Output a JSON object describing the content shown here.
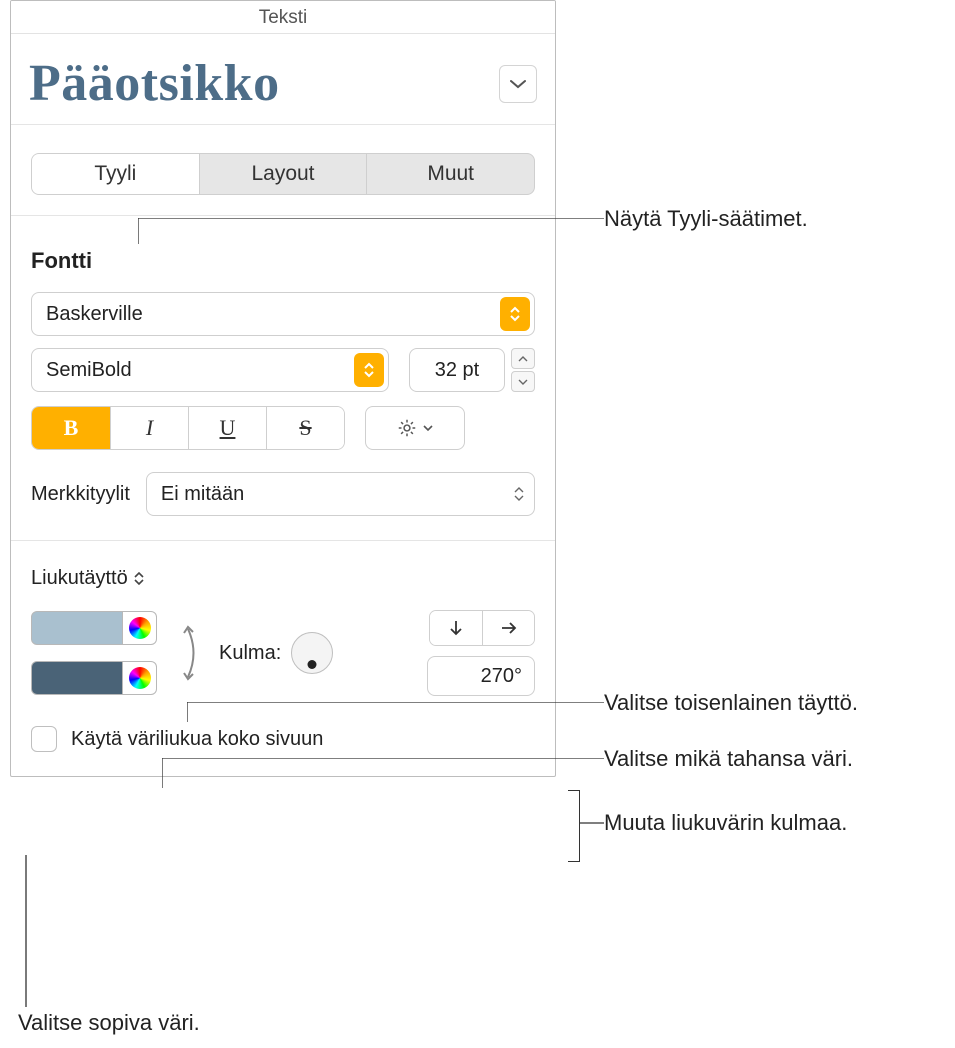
{
  "panel": {
    "title": "Teksti",
    "style_name": "Pääotsikko"
  },
  "tabs": {
    "style": "Tyyli",
    "layout": "Layout",
    "more": "Muut"
  },
  "font": {
    "heading": "Fontti",
    "family": "Baskerville",
    "weight": "SemiBold",
    "size": "32 pt",
    "bold": "B",
    "italic": "I",
    "underline": "U",
    "strike": "S",
    "char_styles_label": "Merkkityylit",
    "char_styles_value": "Ei mitään"
  },
  "fill": {
    "type_label": "Liukutäyttö",
    "angle_label": "Kulma:",
    "angle_value": "270°",
    "checkbox_label": "Käytä väriliukua koko sivuun"
  },
  "callouts": {
    "c1": "Näytä Tyyli-säätimet.",
    "c2": "Valitse toisenlainen täyttö.",
    "c3": "Valitse mikä tahansa väri.",
    "c4": "Muuta liukuvärin kulmaa.",
    "c5": "Valitse sopiva väri."
  }
}
